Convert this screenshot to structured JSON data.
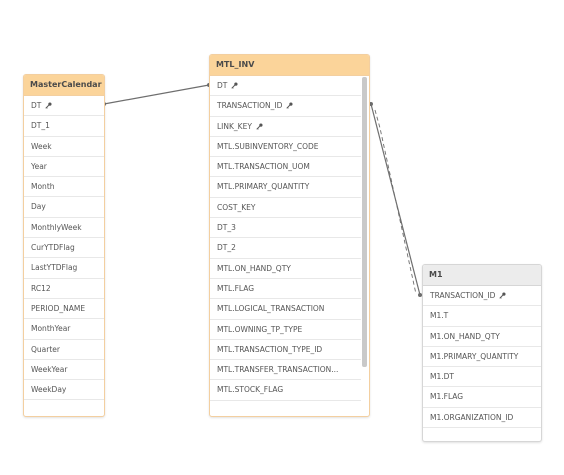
{
  "tables": {
    "master_calendar": {
      "title": "MasterCalendar",
      "fields": [
        "DT",
        "DT_1",
        "Week",
        "Year",
        "Month",
        "Day",
        "MonthlyWeek",
        "CurYTDFlag",
        "LastYTDFlag",
        "RC12",
        "PERIOD_NAME",
        "MonthYear",
        "Quarter",
        "WeekYear",
        "WeekDay"
      ]
    },
    "mtl_inv": {
      "title": "MTL_INV",
      "fields": [
        "DT",
        "TRANSACTION_ID",
        "LINK_KEY",
        "MTL.SUBINVENTORY_CODE",
        "MTL.TRANSACTION_UOM",
        "MTL.PRIMARY_QUANTITY",
        "COST_KEY",
        "DT_3",
        "DT_2",
        "MTL.ON_HAND_QTY",
        "MTL.FLAG",
        "MTL.LOGICAL_TRANSACTION",
        "MTL.OWNING_TP_TYPE",
        "MTL.TRANSACTION_TYPE_ID",
        "MTL.TRANSFER_TRANSACTION...",
        "MTL.STOCK_FLAG"
      ]
    },
    "m1": {
      "title": "M1",
      "fields": [
        "TRANSACTION_ID",
        "M1.T",
        "M1.ON_HAND_QTY",
        "M1.PRIMARY_QUANTITY",
        "M1.DT",
        "M1.FLAG",
        "M1.ORGANIZATION_ID"
      ]
    }
  },
  "key_icon": "key-icon",
  "colors": {
    "selected_header": "#fbd49a",
    "plain_header": "#ececec",
    "link_line": "#6e6e6e"
  }
}
